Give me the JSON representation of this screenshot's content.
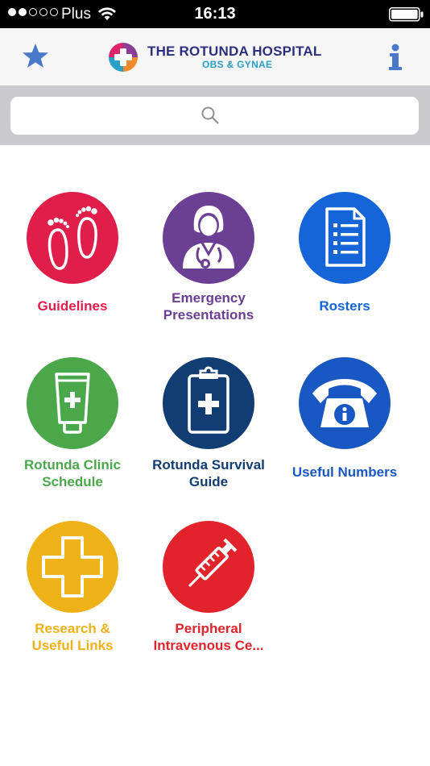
{
  "status_bar": {
    "carrier": "Plus",
    "time": "16:13",
    "signal_bars_filled": 2,
    "signal_bars_total": 5
  },
  "header": {
    "logo_title": "THE ROTUNDA HOSPITAL",
    "logo_subtitle": "OBS & GYNAE",
    "left_icon": "star-icon",
    "right_icon": "info-icon",
    "accent_color": "#4a79c9"
  },
  "search": {
    "placeholder": "",
    "icon": "search-icon"
  },
  "tiles": [
    {
      "label": "Guidelines",
      "icon": "footprints-icon",
      "color": "#e01e4a"
    },
    {
      "label": "Emergency\nPresentations",
      "icon": "doctor-icon",
      "color": "#6a3f94"
    },
    {
      "label": "Rosters",
      "icon": "document-icon",
      "color": "#1565d8"
    },
    {
      "label": "Rotunda Clinic\nSchedule",
      "icon": "cream-tube-icon",
      "color": "#4aa74a"
    },
    {
      "label": "Rotunda Survival\nGuide",
      "icon": "clipboard-icon",
      "color": "#123d73"
    },
    {
      "label": "Useful Numbers",
      "icon": "telephone-icon",
      "color": "#1957c2"
    },
    {
      "label": "Research &\nUseful Links",
      "icon": "cross-icon",
      "color": "#eeb118"
    },
    {
      "label": "Peripheral\nIntravenous Ce...",
      "icon": "syringe-icon",
      "color": "#e3232b"
    }
  ]
}
